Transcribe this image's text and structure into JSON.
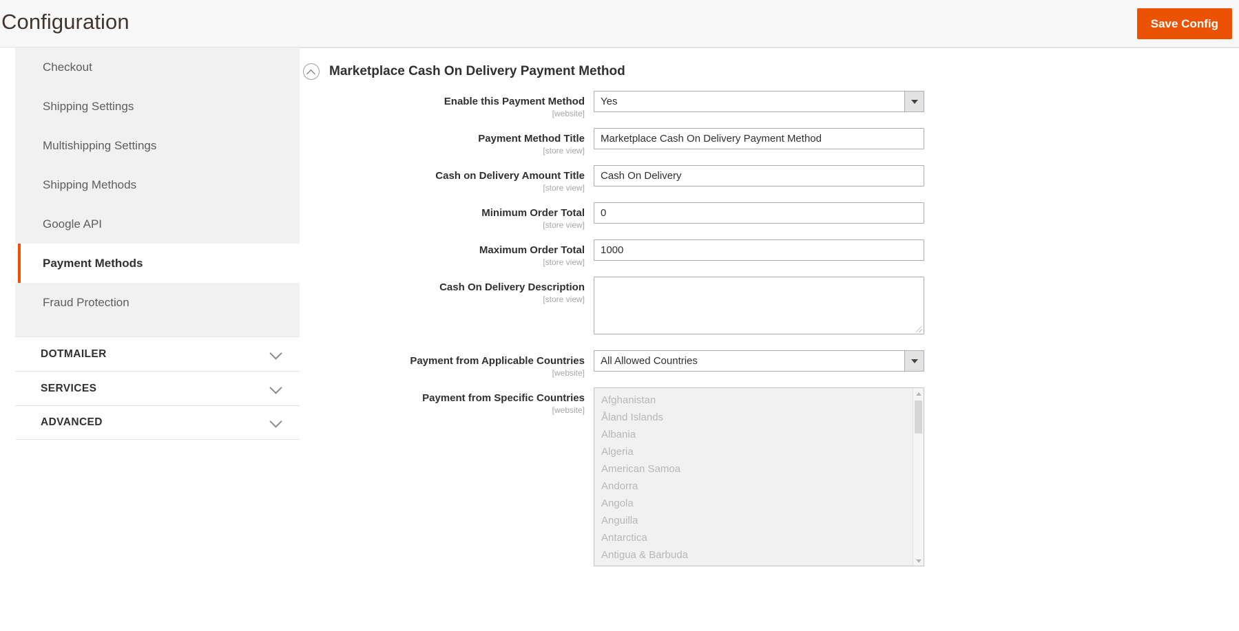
{
  "header": {
    "title": "Configuration",
    "save_label": "Save Config",
    "accent_color": "#eb5202"
  },
  "sidebar": {
    "items": [
      {
        "label": "Checkout",
        "active": false
      },
      {
        "label": "Shipping Settings",
        "active": false
      },
      {
        "label": "Multishipping Settings",
        "active": false
      },
      {
        "label": "Shipping Methods",
        "active": false
      },
      {
        "label": "Google API",
        "active": false
      },
      {
        "label": "Payment Methods",
        "active": true
      },
      {
        "label": "Fraud Protection",
        "active": false
      }
    ],
    "sections": [
      {
        "label": "DOTMAILER",
        "icon": "chevron-down-icon"
      },
      {
        "label": "SERVICES",
        "icon": "chevron-down-icon"
      },
      {
        "label": "ADVANCED",
        "icon": "chevron-down-icon"
      }
    ]
  },
  "main": {
    "section": {
      "title": "Marketplace Cash On Delivery Payment Method",
      "collapse_icon": "chevron-up-circle-icon",
      "expanded": true
    },
    "fields": [
      {
        "label": "Enable this Payment Method",
        "scope": "[website]",
        "type": "select",
        "value": "Yes",
        "name": "enable-payment-method"
      },
      {
        "label": "Payment Method Title",
        "scope": "[store view]",
        "type": "text",
        "value": "Marketplace Cash On Delivery Payment Method",
        "placeholder": "",
        "name": "payment-method-title"
      },
      {
        "label": "Cash on Delivery Amount Title",
        "scope": "[store view]",
        "type": "text",
        "value": "Cash On Delivery",
        "placeholder": "",
        "name": "cod-amount-title"
      },
      {
        "label": "Minimum Order Total",
        "scope": "[store view]",
        "type": "text",
        "value": "0",
        "placeholder": "",
        "name": "minimum-order-total"
      },
      {
        "label": "Maximum Order Total",
        "scope": "[store view]",
        "type": "text",
        "value": "1000",
        "placeholder": "",
        "name": "maximum-order-total"
      },
      {
        "label": "Cash On Delivery Description",
        "scope": "[store view]",
        "type": "textarea",
        "value": "",
        "placeholder": "",
        "name": "cod-description"
      },
      {
        "label": "Payment from Applicable Countries",
        "scope": "[website]",
        "type": "select",
        "value": "All Allowed Countries",
        "name": "applicable-countries"
      },
      {
        "label": "Payment from Specific Countries",
        "scope": "[website]",
        "type": "multiselect",
        "disabled": true,
        "name": "specific-countries",
        "options": [
          "Afghanistan",
          "Åland Islands",
          "Albania",
          "Algeria",
          "American Samoa",
          "Andorra",
          "Angola",
          "Anguilla",
          "Antarctica",
          "Antigua & Barbuda"
        ]
      }
    ]
  }
}
